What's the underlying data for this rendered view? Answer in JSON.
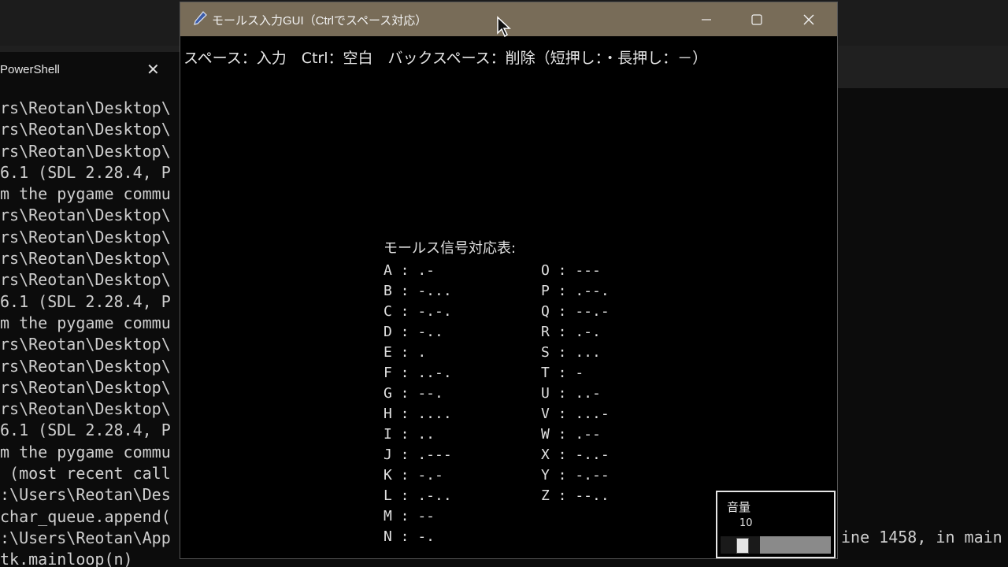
{
  "powershell": {
    "tab_label": "PowerShell",
    "lines": [
      "rs\\Reotan\\Desktop\\",
      "rs\\Reotan\\Desktop\\",
      "rs\\Reotan\\Desktop\\",
      "6.1 (SDL 2.28.4, P",
      "m the pygame commu",
      "rs\\Reotan\\Desktop\\",
      "rs\\Reotan\\Desktop\\",
      "rs\\Reotan\\Desktop\\",
      "rs\\Reotan\\Desktop\\",
      "6.1 (SDL 2.28.4, P",
      "m the pygame commu",
      "rs\\Reotan\\Desktop\\",
      "rs\\Reotan\\Desktop\\",
      "rs\\Reotan\\Desktop\\",
      "rs\\Reotan\\Desktop\\",
      "6.1 (SDL 2.28.4, P",
      "m the pygame commu",
      " (most recent call",
      ":\\Users\\Reotan\\Des",
      "char_queue.append(",
      ":\\Users\\Reotan\\App",
      "tk.mainloop(n)"
    ],
    "right_line": "ine 1458, in main"
  },
  "window": {
    "title": "モールス入力GUI（Ctrlでスペース対応）",
    "instructions": "スペース：入力　Ctrl：空白　バックスペース：削除（短押し：・長押し：－）",
    "table_title": "モールス信号対応表:",
    "morse_left": [
      "A : .-",
      "B : -...",
      "C : -.-.",
      "D : -..",
      "E : .",
      "F : ..-.",
      "G : --.",
      "H : ....",
      "I : ..",
      "J : .---",
      "K : -.-",
      "L : .-..",
      "M : --",
      "N : -."
    ],
    "morse_right": [
      "O : ---",
      "P : .--.",
      "Q : --.-",
      "R : .-.",
      "S : ...",
      "T : -",
      "U : ..-",
      "V : ...-",
      "W : .--",
      "X : -..-",
      "Y : -.--",
      "Z : --.."
    ],
    "volume": {
      "label": "音量",
      "value": "10",
      "level_percent": 36
    }
  },
  "colors": {
    "titlebar": "#786c58",
    "background": "#000000",
    "text": "#e0e0e0"
  },
  "icons": [
    "pen-icon",
    "minimize-icon",
    "maximize-icon",
    "close-icon",
    "mouse-cursor-icon"
  ]
}
